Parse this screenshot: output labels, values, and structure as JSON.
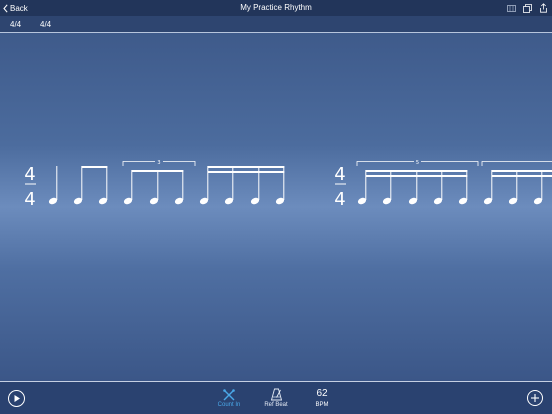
{
  "nav": {
    "back_label": "Back",
    "title": "My Practice Rhythm",
    "icons": [
      "keyboard-icon",
      "duplicate-icon",
      "share-icon"
    ]
  },
  "measures": {
    "labels": [
      "4/4",
      "4/4"
    ]
  },
  "notation": {
    "measure1": {
      "time_signature": {
        "top": "4",
        "bottom": "4"
      },
      "groups": [
        "quarter note",
        "two eighth notes",
        "eighth-note triplet",
        "four sixteenth notes"
      ],
      "tuplet_label": "3"
    },
    "measure2": {
      "time_signature": {
        "top": "4",
        "bottom": "4"
      },
      "groups": [
        "sixteenth-note quintuplet",
        "sixteenth-note group (cut off)"
      ],
      "tuplet_label": "5"
    }
  },
  "toolbar": {
    "play_icon": "play-icon",
    "count_in_label": "Count In",
    "ref_beat_label": "Ref Beat",
    "bpm_value": "62",
    "bpm_label": "BPM",
    "add_icon": "plus-icon"
  },
  "colors": {
    "nav_bg": "#22355a",
    "measure_bar_bg": "#2e4570",
    "toolbar_bg": "#2a4270",
    "accent": "#4aa8e8",
    "notation": "#ffffff"
  }
}
